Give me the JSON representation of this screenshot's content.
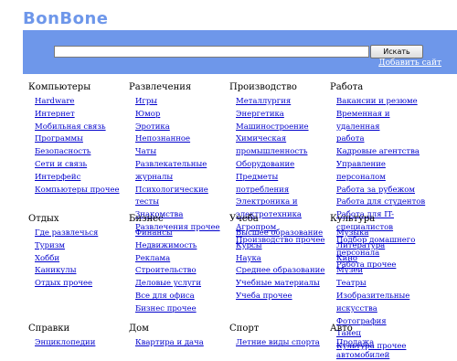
{
  "logo": "BonBone",
  "search": {
    "placeholder": "",
    "value": "",
    "button_label": "Искать"
  },
  "add_site_label": "Добавить сайт",
  "categories": [
    {
      "title": "Компьютеры",
      "links": [
        "Hardware",
        "Интернет",
        "Мобильная связь",
        "Программы",
        "Безопасность",
        "Сети и связь",
        "Интерфейс",
        "Компьютеры прочее"
      ]
    },
    {
      "title": "Развлечения",
      "links": [
        "Игры",
        "Юмор",
        "Эротика",
        "Непознанное",
        "Чаты",
        "Развлекательные",
        "журналы",
        "Психологические тесты",
        "Знакомства",
        "Развлечения прочее"
      ]
    },
    {
      "title": "Производство",
      "links": [
        "Металлургия",
        "Энергетика",
        "Машиностроение",
        "Химическая",
        "промышленность",
        "Оборудование",
        "Предметы потребления",
        "Электроника и",
        "электротехника",
        "Агропром",
        "Производство прочее"
      ]
    },
    {
      "title": "Работа",
      "links": [
        "Вакансии и резюме",
        "Временная и удаленная",
        "работа",
        "Кадровые агентства",
        "Управление персоналом",
        "Работа за рубежом",
        "Работа для студентов",
        "Работа для IT-",
        "специалистов",
        "Подбор домашнего",
        "персонала",
        "Работа прочее"
      ]
    },
    {
      "title": "Отдых",
      "links": [
        "Где развлечься",
        "Туризм",
        "Хобби",
        "Каникулы",
        "Отдых прочее"
      ]
    },
    {
      "title": "Бизнес",
      "links": [
        "Финансы",
        "Недвижимость",
        "Реклама",
        "Строительство",
        "Деловые услуги",
        "Все для офиса",
        "Бизнес прочее"
      ]
    },
    {
      "title": "Учеба",
      "links": [
        "Высшее образование",
        "Курсы",
        "Наука",
        "Среднее образование",
        "Учебные материалы",
        "Учеба прочее"
      ]
    },
    {
      "title": "Культура",
      "links": [
        "Музыка",
        "Литература",
        "Кино",
        "Музеи",
        "Театры",
        "Изобразительные",
        "искусства",
        "Фотография",
        "Танец",
        "Культура прочее"
      ]
    },
    {
      "title": "Справки",
      "links": [
        "Энциклопедии"
      ]
    },
    {
      "title": "Дом",
      "links": [
        "Квартира и дача"
      ]
    },
    {
      "title": "Спорт",
      "links": [
        "Летние виды спорта"
      ]
    },
    {
      "title": "Авто",
      "links": [
        "Продажа автомобилей"
      ]
    }
  ]
}
